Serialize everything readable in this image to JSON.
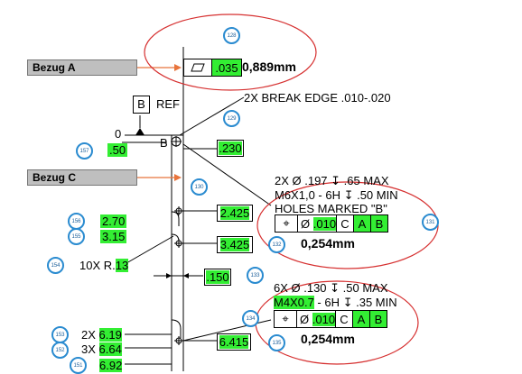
{
  "datum_labels": {
    "a": "Bezug A",
    "c": "Bezug C"
  },
  "flatness": {
    "tolerance": ".035",
    "metric": "0,889mm"
  },
  "datum_b": {
    "letter": "B",
    "note": "REF",
    "zero_top": "0",
    "zero_left": "0",
    "letter_side": "B"
  },
  "break_edge_note": "2X BREAK EDGE .010-.020",
  "dimensions": {
    "d050": ".50",
    "d230": ".230",
    "d2425": "2.425",
    "d3425": "3.425",
    "d270": "2.70",
    "d315": "3.15",
    "radius_prefix": "10X R.",
    "radius_value": "13",
    "d150": ".150",
    "d6415": "6.415",
    "d619_prefix": "2X",
    "d619": "6.19",
    "d664_prefix": "3X",
    "d664": "6.64",
    "d692": "6.92"
  },
  "hole_note_1": {
    "line1": "2X  Ø  .197  ↧  .65 MAX",
    "line2": "M6X1,0 - 6H ↧ .50 MIN",
    "line3": "HOLES MARKED \"B\""
  },
  "position_1": {
    "symbol": "⌖",
    "dia": "Ø",
    "tol": ".010",
    "ref1": "C",
    "ref2": "A",
    "ref3": "B",
    "metric": "0,254mm"
  },
  "hole_note_2": {
    "line1": "6X  Ø  .130  ↧  .50 MAX",
    "line2a": "M4X0.7",
    "line2b": " - 6H ↧ .35 MIN"
  },
  "position_2": {
    "symbol": "⌖",
    "dia": "Ø",
    "tol": ".010",
    "ref1": "C",
    "ref2": "A",
    "ref3": "B",
    "metric": "0,254mm"
  },
  "balloons": {
    "b128": "128",
    "b129": "129",
    "b157": "157",
    "b130": "130",
    "b131": "131",
    "b132": "132",
    "b156": "156",
    "b155": "155",
    "b154": "154",
    "b133": "133",
    "b134": "134",
    "b135": "135",
    "b153": "153",
    "b152": "152",
    "b151": "151"
  },
  "colors": {
    "highlight": "#33ee33",
    "balloon": "#2a8bd0",
    "callout_ellipse": "#d63030",
    "datum_arrow": "#e8743c"
  }
}
